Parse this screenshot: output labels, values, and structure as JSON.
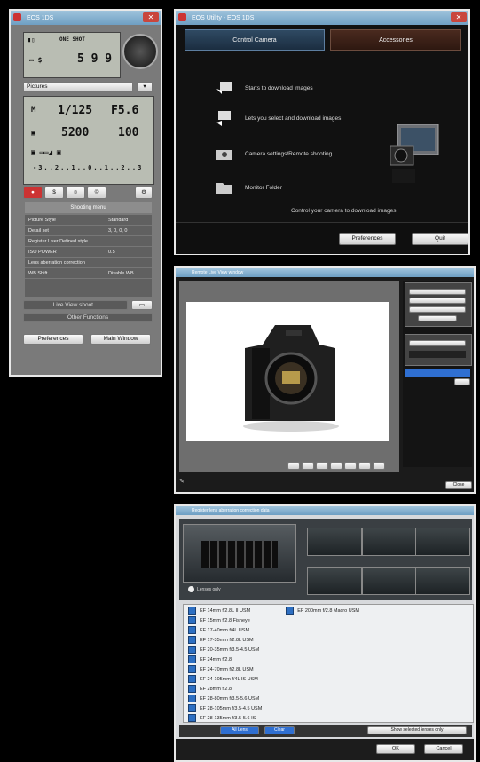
{
  "panel": {
    "title": "EOS 1DS",
    "shots_label": "ONE SHOT",
    "shots_count": "5 9 9",
    "picture_style": "Pictures",
    "shutter": "1/125",
    "aperture": "F5.6",
    "kelvin": "5200",
    "iso": "100",
    "tabs": [
      "●",
      "$",
      "¤",
      "©"
    ],
    "menu_header": "Shooting menu",
    "menu_rows": [
      {
        "label": "Picture Style",
        "value": "Standard"
      },
      {
        "label": "Detail set",
        "value": "3, 0, 0, 0"
      },
      {
        "label": "Register User Defined style",
        "value": ""
      },
      {
        "label": "ISO POWER",
        "value": "0.5"
      },
      {
        "label": "Lens aberration correction",
        "value": ""
      },
      {
        "label": "WB Shift",
        "value": "Disable WB"
      }
    ],
    "live_view_btn": "Live View shoot...",
    "other_functions_btn": "Other Functions",
    "preferences_btn": "Preferences",
    "main_window_btn": "Main Window"
  },
  "eos_utility": {
    "title": "EOS Utility - EOS 1DS",
    "tab_control": "Control Camera",
    "tab_accessories": "Accessories",
    "items": [
      "Starts to download images",
      "Lets you select and download images",
      "Camera settings/Remote shooting",
      "Monitor Folder"
    ],
    "caption": "Control your camera to download images",
    "preferences_btn": "Preferences",
    "quit_btn": "Quit"
  },
  "live_view": {
    "title": "Remote Live View window",
    "close_btn": "Close"
  },
  "lens_register": {
    "title": "Register lens aberration correction data",
    "checkbox_label": "Lenses only",
    "highlight_lens": "EF 200mm f/2.8 Macro USM",
    "lenses": [
      "EF 14mm f/2.8L II USM",
      "EF 15mm f/2.8 Fisheye",
      "EF 17-40mm f/4L USM",
      "EF 17-35mm f/2.8L USM",
      "EF 20-35mm f/3.5-4.5 USM",
      "EF 24mm f/2.8",
      "EF 24-70mm f/2.8L USM",
      "EF 24-105mm f/4L IS USM",
      "EF 28mm f/2.8",
      "EF 28-80mm f/3.5-5.6 USM",
      "EF 28-105mm f/3.5-4.5 USM",
      "EF 28-135mm f/3.5-5.6 IS"
    ],
    "select_all": "All Lens",
    "clear": "Clear",
    "show_selected": "Show selected lenses only",
    "ok_btn": "OK",
    "cancel_btn": "Cancel"
  }
}
